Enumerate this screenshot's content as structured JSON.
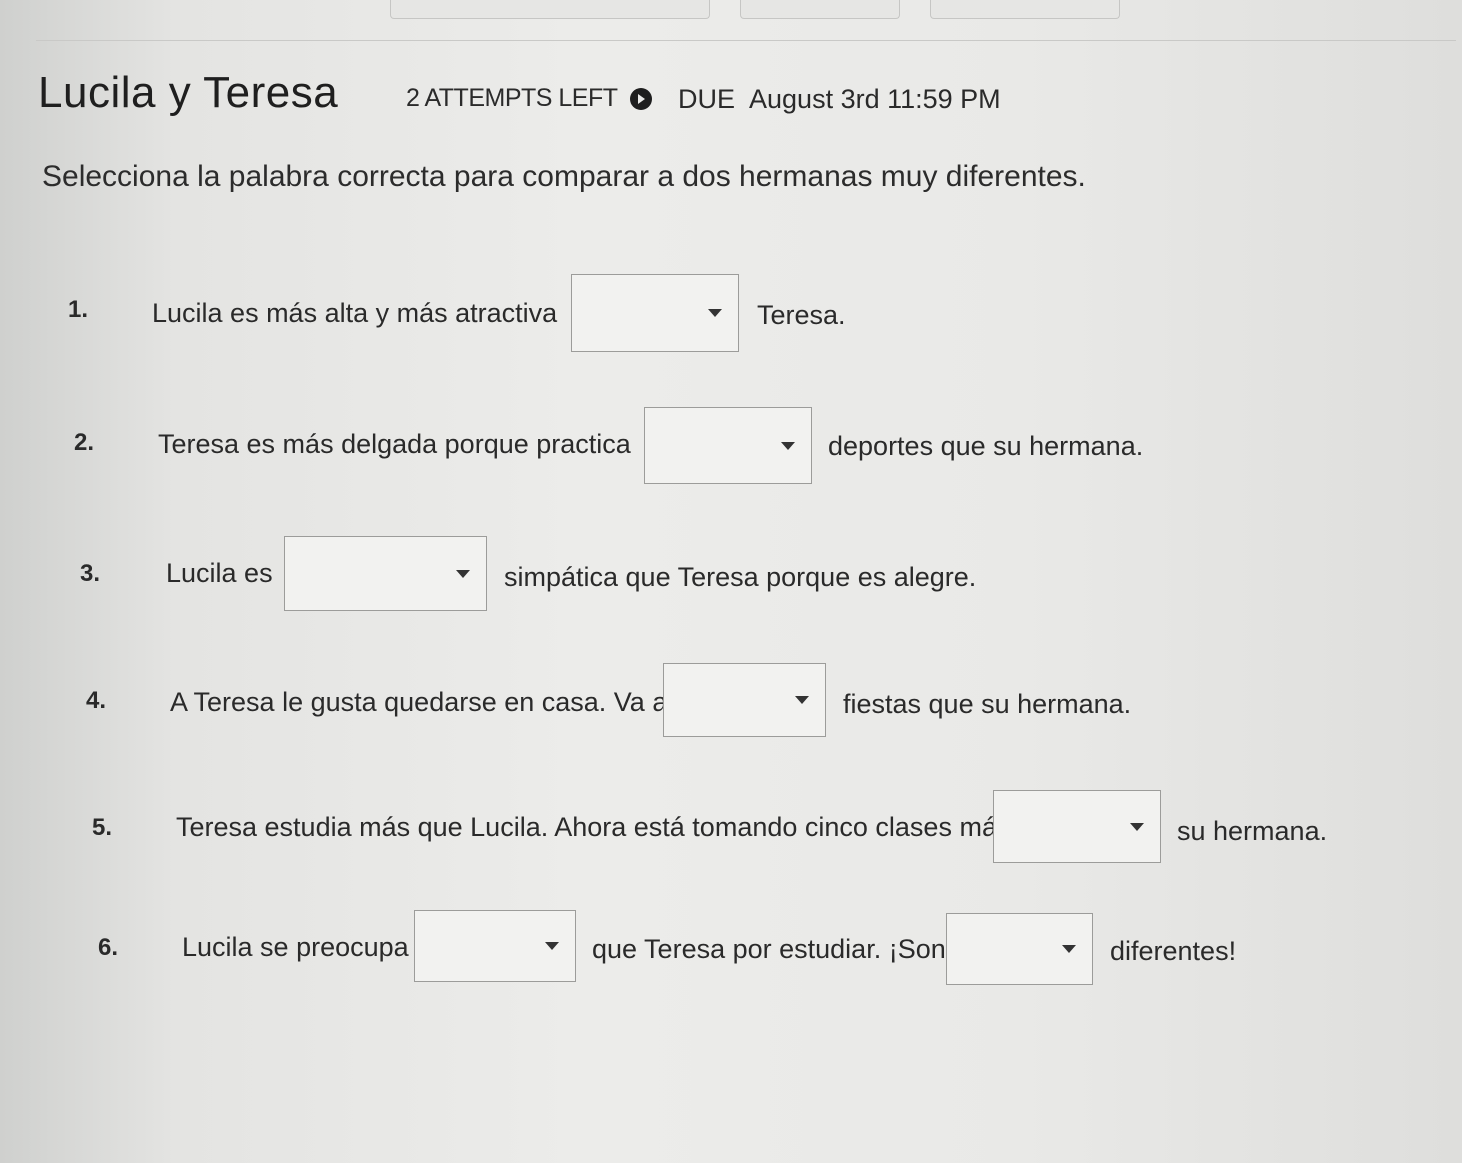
{
  "header": {
    "title": "Lucila y Teresa",
    "attempts": "2 ATTEMPTS LEFT",
    "due_label": "DUE",
    "due_date": "August 3rd 11:59 PM"
  },
  "instructions": "Selecciona la palabra correcta para comparar a dos hermanas muy diferentes.",
  "questions": [
    {
      "number": "1.",
      "before": "Lucila es más alta y más atractiva",
      "after": "Teresa.",
      "answer": ""
    },
    {
      "number": "2.",
      "before": "Teresa es más delgada porque practica",
      "after": "deportes que su hermana.",
      "answer": ""
    },
    {
      "number": "3.",
      "before": "Lucila es",
      "after": "simpática que Teresa porque es alegre.",
      "answer": ""
    },
    {
      "number": "4.",
      "before": "A Teresa le gusta quedarse en casa. Va a",
      "after": "fiestas que su hermana.",
      "answer": ""
    },
    {
      "number": "5.",
      "before": "Teresa estudia más que Lucila. Ahora está tomando cinco clases más",
      "after": "su hermana.",
      "answer": ""
    },
    {
      "number": "6.",
      "before": "Lucila se preocupa",
      "middle": "que Teresa por estudiar. ¡Son",
      "after": "diferentes!",
      "answer": "",
      "answer2": ""
    }
  ]
}
